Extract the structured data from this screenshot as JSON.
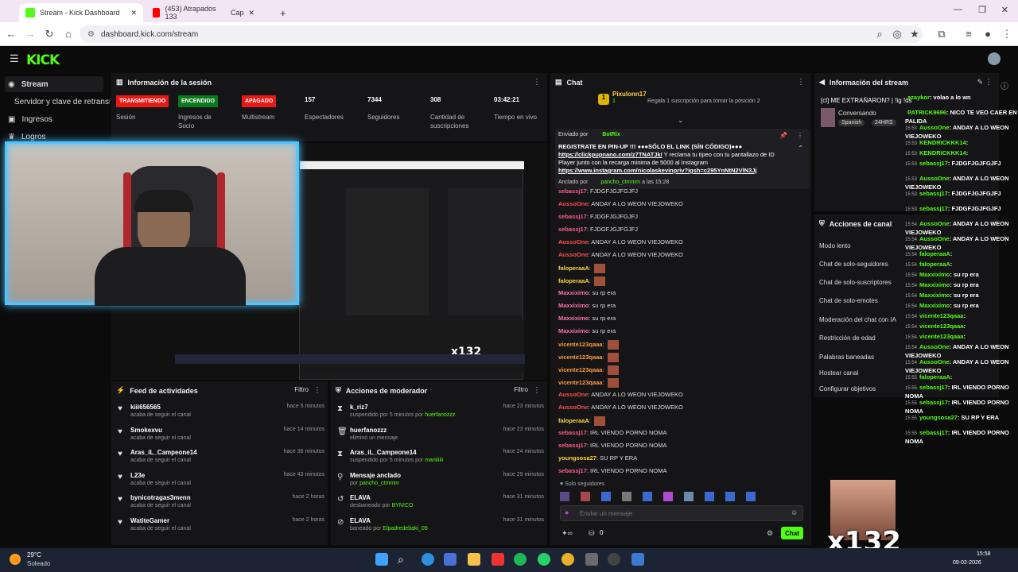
{
  "browser": {
    "tabs": [
      {
        "label": "Stream - Kick Dashboard",
        "active": true
      },
      {
        "label": "(453) Atrapados 133",
        "active": false
      },
      {
        "label": "Cap",
        "active": false
      }
    ],
    "url": "dashboard.kick.com/stream"
  },
  "kick": {
    "logo": "KICK"
  },
  "sidebar": {
    "items": [
      {
        "label": "Stream",
        "icon": "broadcast-icon"
      },
      {
        "label": "Servidor y clave de retransmisión",
        "icon": "key-icon"
      },
      {
        "label": "Ingresos",
        "icon": "dollar-icon"
      },
      {
        "label": "Logros",
        "icon": "trophy-icon"
      }
    ]
  },
  "session": {
    "title": "Información de la sesión",
    "badges": [
      {
        "text": "TRANSMITIENDO",
        "label": "Sesión",
        "color": "#e91916"
      },
      {
        "text": "ENCENDIDO",
        "label": "Ingresos de Socio",
        "color": "#0a7a1a"
      },
      {
        "text": "APAGADO",
        "label": "Multistream",
        "color": "#e91916"
      }
    ],
    "stats": [
      {
        "value": "157",
        "label": "Espectadores"
      },
      {
        "value": "7344",
        "label": "Seguidores"
      },
      {
        "value": "308",
        "label": "Cantidad de suscripciones"
      },
      {
        "value": "03:42:21",
        "label": "Tiempo en vivo"
      }
    ]
  },
  "overlay": {
    "multiplier": "x132"
  },
  "activity_feed": {
    "title": "Feed de actividades",
    "filter": "Filtro",
    "items": [
      {
        "name": "kiii656565",
        "sub": "acaba de seguir el canal",
        "time": "hace 5 minutos"
      },
      {
        "name": "Smokexvu",
        "sub": "acaba de seguir el canal",
        "time": "hace 14 minutos"
      },
      {
        "name": "Aras_iL_Campeone14",
        "sub": "acaba de seguir el canal",
        "time": "hace 36 minutos"
      },
      {
        "name": "L23e",
        "sub": "acaba de seguir el canal",
        "time": "hace 43 minutos"
      },
      {
        "name": "bynicotragas3menn",
        "sub": "acaba de seguir el canal",
        "time": "hace 2 horas"
      },
      {
        "name": "WatiteGamer",
        "sub": "acaba de seguir el canal",
        "time": "hace 2 horas"
      }
    ]
  },
  "mod_actions": {
    "title": "Acciones de moderador",
    "filter": "Filtro",
    "items": [
      {
        "name": "k_riz7",
        "sub": "suspendido por 5 minutos por",
        "by": "huerfanozzz",
        "time": "hace 23 minutos",
        "icon": "hourglass-icon"
      },
      {
        "name": "huerfanozzz",
        "sub": "eliminó un mensaje",
        "by": "",
        "time": "hace 23 minutos",
        "icon": "trash-icon"
      },
      {
        "name": "Aras_iL_Campeone14",
        "sub": "suspendido por 5 minutos por",
        "by": "mariiiiiii",
        "time": "hace 24 minutos",
        "icon": "hourglass-icon"
      },
      {
        "name": "Mensaje anclado",
        "sub": "por",
        "by": "pancho_ctmmm",
        "time": "hace 29 minutos",
        "icon": "pin-icon"
      },
      {
        "name": "ELAVA",
        "sub": "desbaneado por",
        "by": "BYN!CO",
        "time": "hace 31 minutos",
        "icon": "undo-icon"
      },
      {
        "name": "ELAVA",
        "sub": "baneado por",
        "by": "Elpadredebaki_09",
        "time": "hace 31 minutos",
        "icon": "ban-icon"
      }
    ]
  },
  "chat": {
    "title": "Chat",
    "top_gifter": "Pixulonn17",
    "top_gifter_count": "1",
    "gift_prompt": "Regala 1 suscripción para tomar la posición 2",
    "pinned": {
      "sent_by": "Enviado por",
      "bot": "BotRix",
      "line1": "REGISTRATE EN PIN-UP",
      "line1b": "!!! ●●●SÓLO EL LINK (SÍN CÓDIGO)●●●",
      "link1": "https://clickpupnano.com/z7TNATJk/",
      "text2": "Y reclama tu tipeo con tu pantallazo de ID Player junto con la recarga minima de 5000 al Instagram",
      "link2": "https://www.instagram.com/nicolaskevinpriv?igsh=c295YnNtN2VlN3Jj",
      "pinned_by": "Anclado por",
      "pinned_user": "pancho_ctmmm",
      "pinned_time": "a las 15:28"
    },
    "messages": [
      {
        "user": "sebassj17",
        "text": ": FJDGFJGJFGJFJ",
        "color": "#ff5c8a"
      },
      {
        "user": "AussoOne",
        "text": ": ANDAY A LO WEON VIEJOWEKO",
        "color": "#ff4d4d"
      },
      {
        "user": "sebassj17",
        "text": ": FJDGFJGJFGJFJ",
        "color": "#ff5c8a"
      },
      {
        "user": "sebassj17",
        "text": ": FJDGFJGJFGJFJ",
        "color": "#ff5c8a"
      },
      {
        "user": "AussoOne",
        "text": ": ANDAY A LO WEON VIEJOWEKO",
        "color": "#ff4d4d"
      },
      {
        "user": "AussoOne",
        "text": ": ANDAY A LO WEON VIEJOWEKO",
        "color": "#ff4d4d"
      },
      {
        "user": "faloperaaA",
        "text": ":",
        "color": "#ffd23f"
      },
      {
        "user": "faloperaaA",
        "text": ":",
        "color": "#ffd23f"
      },
      {
        "user": "Maxxiximo",
        "text": ": su rp era",
        "color": "#ff6fb1"
      },
      {
        "user": "Maxxiximo",
        "text": ": su rp era",
        "color": "#ff6fb1"
      },
      {
        "user": "Maxxiximo",
        "text": ": su rp era",
        "color": "#ff6fb1"
      },
      {
        "user": "Maxxiximo",
        "text": ": su rp era",
        "color": "#ff6fb1"
      },
      {
        "user": "vicente123qaaa",
        "text": ":",
        "color": "#ff9a3c"
      },
      {
        "user": "vicente123qaaa",
        "text": ":",
        "color": "#ff9a3c"
      },
      {
        "user": "vicente123qaaa",
        "text": ":",
        "color": "#ff9a3c"
      },
      {
        "user": "vicente123qaaa",
        "text": ":",
        "color": "#ff9a3c"
      },
      {
        "user": "AussoOne",
        "text": ": ANDAY A LO WEON VIEJOWEKO",
        "color": "#ff4d4d"
      },
      {
        "user": "AussoOne",
        "text": ": ANDAY A LO WEON VIEJOWEKO",
        "color": "#ff4d4d"
      },
      {
        "user": "faloperaaA",
        "text": ":",
        "color": "#ffd23f"
      },
      {
        "user": "sebassj17",
        "text": ": IRL VIENDO PORNO NOMA",
        "color": "#ff5c8a"
      },
      {
        "user": "sebassj17",
        "text": ": IRL VIENDO PORNO NOMA",
        "color": "#ff5c8a"
      },
      {
        "user": "youngsosa27",
        "text": ": SU RP Y ERA",
        "color": "#ffd23f"
      },
      {
        "user": "sebassj17",
        "text": ": IRL VIENDO PORNO NOMA",
        "color": "#ff5c8a"
      }
    ],
    "followers_only": "Solo seguidores",
    "input_placeholder": "Enviar un mensaje",
    "points": "0",
    "send": "Chat"
  },
  "stream_info": {
    "title": "Información del stream",
    "stream_title": "[cl] ME EXTRAÑARON? | !ig !ds !vocal",
    "category": "Conversando",
    "tags": [
      "Spanish",
      "24HRS"
    ]
  },
  "channel_actions": {
    "title": "Acciones de canal",
    "items": [
      "Modo lento",
      "Chat de solo-seguidores",
      "Chat de solo-suscriptores",
      "Chat de solo-emotes",
      "Moderación del chat con IA",
      "Restricción de edad",
      "Palabras baneadas",
      "Hostear canal",
      "Configurar objetivos"
    ]
  },
  "overlay_chat": [
    {
      "user": "azaykor",
      "text": ": volao a lo wn",
      "time": ""
    },
    {
      "user": "PATRICK9696",
      "text": ": NICO TE VEO CAER EN PALIDA",
      "time": ""
    },
    {
      "user": "AussoOne",
      "text": ": ANDAY A LO WEON VIEJOWEKO",
      "time": "15:53"
    },
    {
      "user": "KENDRICKKK14",
      "text": ":",
      "time": "15:53"
    },
    {
      "user": "KENDRICKKK14",
      "text": ":",
      "time": "15:53"
    },
    {
      "user": "sebassj17",
      "text": ": FJDGFJGJFGJFJ",
      "time": "15:53"
    },
    {
      "user": "AussoOne",
      "text": ": ANDAY A LO WEON VIEJOWEKO",
      "time": "15:53"
    },
    {
      "user": "sebassj17",
      "text": ": FJDGFJGJFGJFJ",
      "time": "15:53"
    },
    {
      "user": "sebassj17",
      "text": ": FJDGFJGJFGJFJ",
      "time": "15:53"
    },
    {
      "user": "AussoOne",
      "text": ": ANDAY A LO WEON VIEJOWEKO",
      "time": "15:54"
    },
    {
      "user": "AussoOne",
      "text": ": ANDAY A LO WEON VIEJOWEKO",
      "time": "15:54"
    },
    {
      "user": "faloperaaA",
      "text": ":",
      "time": "15:54"
    },
    {
      "user": "faloperaaA",
      "text": ":",
      "time": "15:54"
    },
    {
      "user": "Maxxiximo",
      "text": ": su rp era",
      "time": "15:54"
    },
    {
      "user": "Maxxiximo",
      "text": ": su rp era",
      "time": "15:54"
    },
    {
      "user": "Maxxiximo",
      "text": ": su rp era",
      "time": "15:54"
    },
    {
      "user": "Maxxiximo",
      "text": ": su rp era",
      "time": "15:54"
    },
    {
      "user": "vicente123qaaa",
      "text": ":",
      "time": "15:54"
    },
    {
      "user": "vicente123qaaa",
      "text": ":",
      "time": "15:54"
    },
    {
      "user": "vicente123qaaa",
      "text": ":",
      "time": "15:54"
    },
    {
      "user": "AussoOne",
      "text": ": ANDAY A LO WEON VIEJOWEKO",
      "time": "15:54"
    },
    {
      "user": "AussoOne",
      "text": ": ANDAY A LO WEON VIEJOWEKO",
      "time": "15:54"
    },
    {
      "user": "faloperaaA",
      "text": ":",
      "time": "15:55"
    },
    {
      "user": "sebassj17",
      "text": ": IRL VIENDO PORNO NOMA",
      "time": "15:55"
    },
    {
      "user": "sebassj17",
      "text": ": IRL VIENDO PORNO NOMA",
      "time": "15:55"
    },
    {
      "user": "youngsosa27",
      "text": ": SU RP Y ERA",
      "time": "15:55"
    },
    {
      "user": "sebassj17",
      "text": ": IRL VIENDO PORNO NOMA",
      "time": "15:55"
    }
  ],
  "taskbar": {
    "temp": "29°C",
    "weather": "Soleado",
    "time": "15:58",
    "date": "09-02-2026"
  },
  "colors": {
    "kick_green": "#53fc18",
    "live_red": "#e91916",
    "panel": "#151517",
    "background": "#0b0b0c"
  }
}
